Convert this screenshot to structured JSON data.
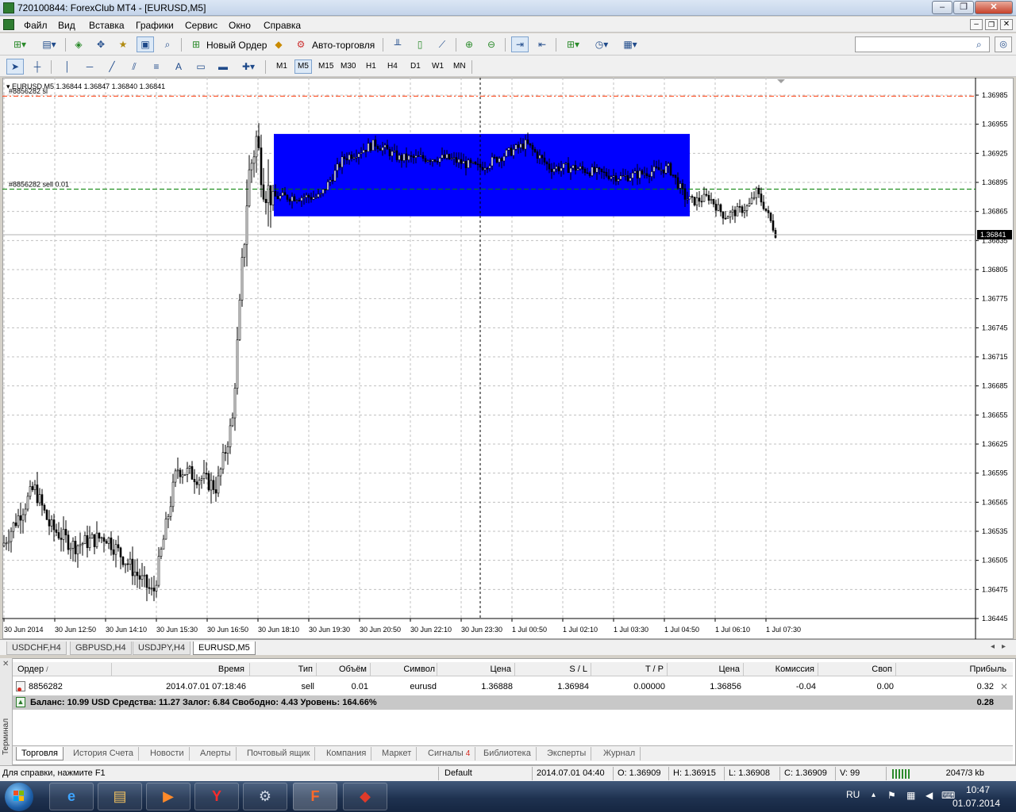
{
  "window": {
    "title": "720100844: ForexClub MT4 - [EURUSD,M5]"
  },
  "menu": [
    "Файл",
    "Вид",
    "Вставка",
    "Графики",
    "Сервис",
    "Окно",
    "Справка"
  ],
  "toolbar": {
    "new_order_label": "Новый Ордер",
    "auto_trading_label": "Авто-торговля"
  },
  "timeframes": [
    "M1",
    "M5",
    "M15",
    "M30",
    "H1",
    "H4",
    "D1",
    "W1",
    "MN"
  ],
  "timeframe_active": "M5",
  "chart": {
    "header": "EURUSD,M5  1.36844 1.36847 1.36840 1.36841",
    "order_sl_label": "#8856282 sl",
    "order_label": "#8856282 sell 0.01",
    "price_levels": [
      "1.36985",
      "1.36955",
      "1.36925",
      "1.36895",
      "1.36865",
      "1.36835",
      "1.36805",
      "1.36775",
      "1.36745",
      "1.36715",
      "1.36685",
      "1.36655",
      "1.36625",
      "1.36595",
      "1.36565",
      "1.36535",
      "1.36505",
      "1.36475",
      "1.36445"
    ],
    "current_price": "1.36841",
    "time_labels": [
      "30 Jun 2014",
      "30 Jun 12:50",
      "30 Jun 14:10",
      "30 Jun 15:30",
      "30 Jun 16:50",
      "30 Jun 18:10",
      "30 Jun 19:30",
      "30 Jun 20:50",
      "30 Jun 22:10",
      "30 Jun 23:30",
      "1 Jul 00:50",
      "1 Jul 02:10",
      "1 Jul 03:30",
      "1 Jul 04:50",
      "1 Jul 06:10",
      "1 Jul 07:30"
    ],
    "colors": {
      "bull": "#000000",
      "bear": "#000000",
      "rectangle": "#0000ff",
      "sl_line": "#ff3300",
      "order_line": "#008000",
      "grid": "#c0c0c0"
    }
  },
  "chart_tabs": [
    "USDCHF,H4",
    "GBPUSD,H4",
    "USDJPY,H4",
    "EURUSD,M5"
  ],
  "chart_tab_active": "EURUSD,M5",
  "terminal": {
    "side_label": "Терминал",
    "columns": [
      "Ордер",
      "Время",
      "Тип",
      "Объём",
      "Символ",
      "Цена",
      "S / L",
      "T / P",
      "Цена",
      "Комиссия",
      "Своп",
      "Прибыль"
    ],
    "order": {
      "id": "8856282",
      "time": "2014.07.01 07:18:46",
      "type": "sell",
      "volume": "0.01",
      "symbol": "eurusd",
      "open_price": "1.36888",
      "sl": "1.36984",
      "tp": "0.00000",
      "price": "1.36856",
      "commission": "-0.04",
      "swap": "0.00",
      "profit": "0.32"
    },
    "balance_text": "Баланс: 10.99 USD  Средства: 11.27  Залог: 6.84  Свободно: 4.43  Уровень: 164.66%",
    "balance_profit": "0.28",
    "tabs": [
      "Торговля",
      "История Счета",
      "Новости",
      "Алерты",
      "Почтовый ящик",
      "Компания",
      "Маркет",
      "Сигналы",
      "Библиотека",
      "Эксперты",
      "Журнал"
    ],
    "signals_badge": "4"
  },
  "status": {
    "help": "Для справки, нажмите F1",
    "profile": "Default",
    "datetime": "2014.07.01 04:40",
    "open": "O: 1.36909",
    "high": "H: 1.36915",
    "low": "L: 1.36908",
    "close": "C: 1.36909",
    "volume": "V: 99",
    "traffic": "2047/3 kb"
  },
  "taskbar": {
    "lang": "RU",
    "time": "10:47",
    "date": "01.07.2014"
  }
}
